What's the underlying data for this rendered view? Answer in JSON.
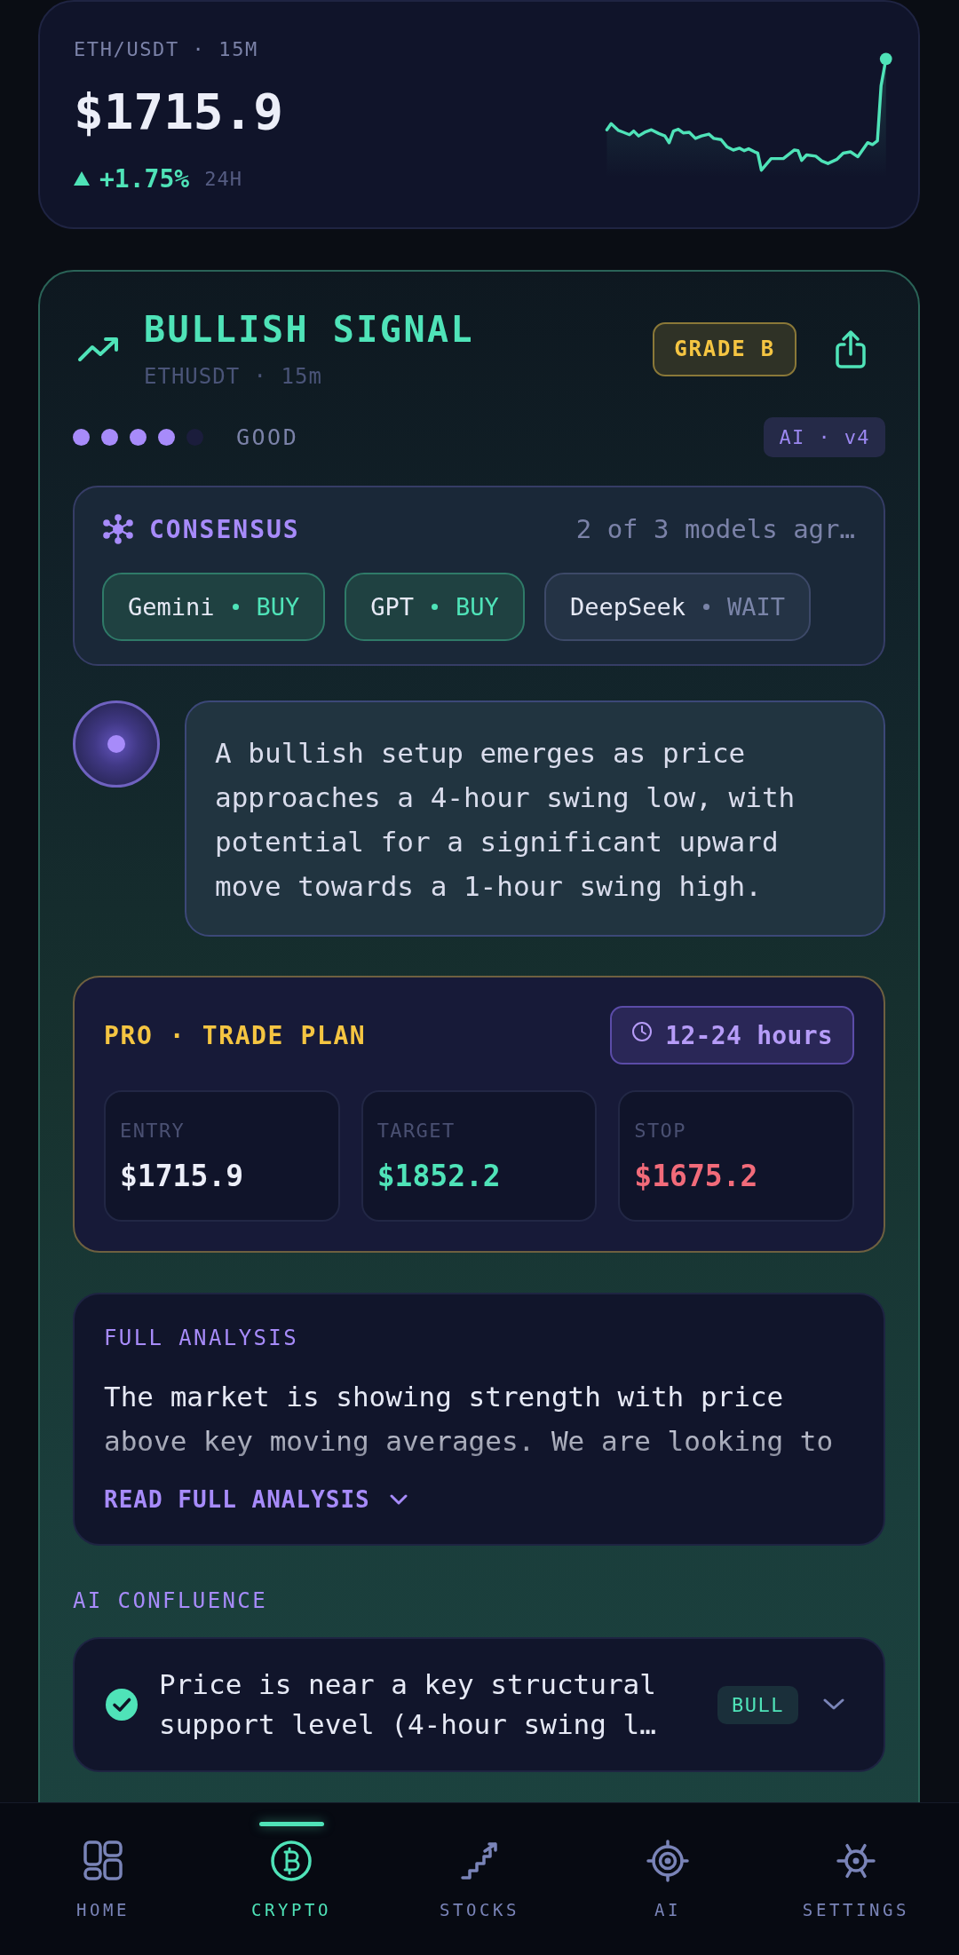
{
  "ticker": {
    "pair": "ETH/USDT · 15M",
    "price": "$1715.9",
    "rising": true,
    "change": "+1.75%",
    "period": "24H"
  },
  "signal": {
    "title": "BULLISH SIGNAL",
    "symbol": "ETHUSDT · 15m",
    "grade": "GRADE B",
    "strength": {
      "stars": 4,
      "label": "GOOD"
    },
    "model_tag": "AI · v4"
  },
  "consensus": {
    "title": "CONSENSUS",
    "summary": "2 of 3 models agr…",
    "models": [
      {
        "name": "Gemini",
        "vote": "BUY",
        "agrees": true
      },
      {
        "name": "GPT",
        "vote": "BUY",
        "agrees": true
      },
      {
        "name": "DeepSeek",
        "vote": "WAIT",
        "agrees": false
      }
    ]
  },
  "commentary": {
    "text": "A bullish setup emerges as price approaches a 4-hour swing low, with potential for a significant upward move towards a 1-hour swing high."
  },
  "trade_plan": {
    "title": "PRO · TRADE PLAN",
    "duration": "12-24 hours",
    "levels": [
      {
        "kind": "entry",
        "label": "ENTRY",
        "value": "$1715.9"
      },
      {
        "kind": "target",
        "label": "TARGET",
        "value": "$1852.2"
      },
      {
        "kind": "stop",
        "label": "STOP",
        "value": "$1675.2"
      }
    ]
  },
  "analysis": {
    "title": "FULL ANALYSIS",
    "text": "The market is showing strength with price above key moving averages. We are looking to",
    "link": "READ FULL ANALYSIS"
  },
  "confluence": {
    "title": "AI CONFLUENCE",
    "items": [
      {
        "text": "Price is near a key structural support level (4-hour swing l…",
        "tag": "BULL",
        "checked": true
      }
    ]
  },
  "nav": {
    "items": [
      {
        "kind": "home",
        "label": "HOME",
        "selected": false
      },
      {
        "kind": "crypto",
        "label": "CRYPTO",
        "selected": true
      },
      {
        "kind": "stocks",
        "label": "STOCKS",
        "selected": false
      },
      {
        "kind": "ai",
        "label": "AI",
        "selected": false
      },
      {
        "kind": "settings",
        "label": "SETTINGS",
        "selected": false
      }
    ]
  }
}
